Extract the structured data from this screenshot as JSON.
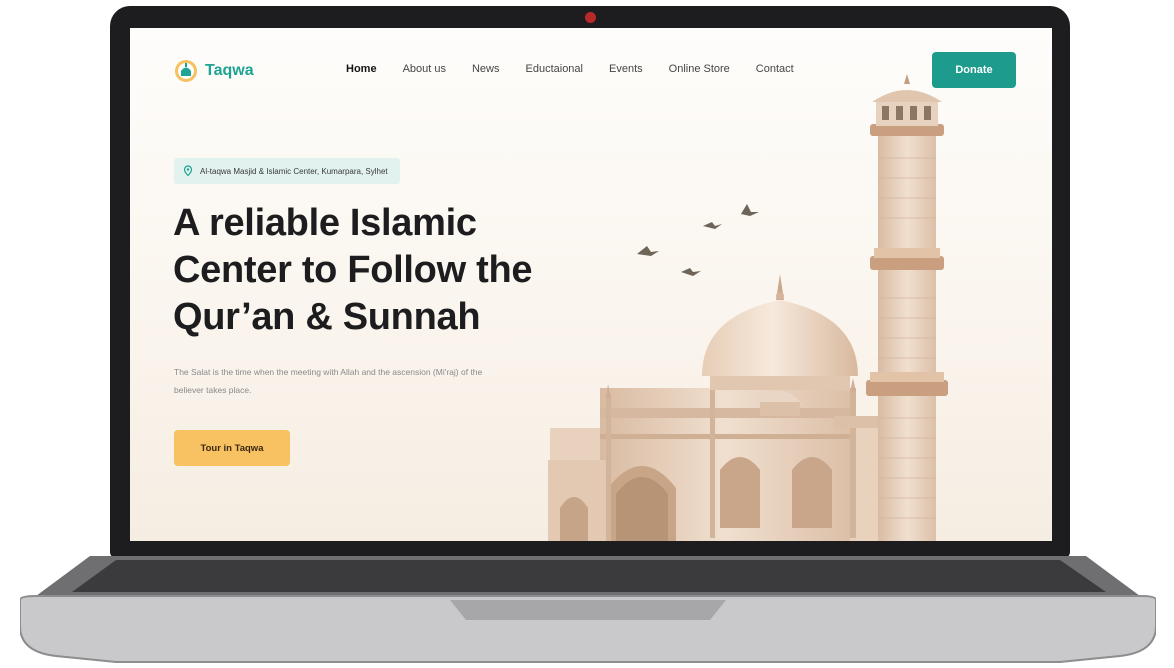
{
  "brand": {
    "name": "Taqwa",
    "icon": "mosque-lantern-icon"
  },
  "nav": {
    "items": [
      "Home",
      "About us",
      "News",
      "Eductaional",
      "Events",
      "Online Store",
      "Contact"
    ],
    "active": "Home"
  },
  "donate": {
    "label": "Donate"
  },
  "hero": {
    "location": "Al-taqwa Masjid & Islamic Center, Kumarpara, Sylhet",
    "title": "A reliable Islamic Center to Follow the Qur’an & Sunnah",
    "description": "The Salat is the time when the meeting with Allah and the ascension (Mi'raj) of the believer takes place.",
    "cta_label": "Tour in Taqwa"
  },
  "colors": {
    "accent": "#1d9c8e",
    "cta": "#f8c162",
    "badge_bg": "#e2f2ef",
    "heading": "#1d1d1f",
    "marble": "#e9d5c2"
  }
}
